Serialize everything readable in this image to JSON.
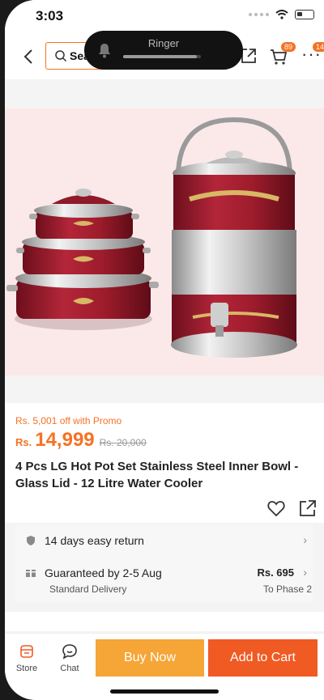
{
  "status_bar": {
    "time": "3:03"
  },
  "header": {
    "search_text": "Sea",
    "cart_badge": "89",
    "more_badge": "14"
  },
  "ringer": {
    "label": "Ringer",
    "level": 0.95
  },
  "product": {
    "promo": "Rs. 5,001 off with Promo",
    "currency": "Rs.",
    "price": "14,999",
    "old_price": "Rs. 20,000",
    "title": "4 Pcs LG Hot Pot Set Stainless Steel Inner Bowl - Glass Lid - 12 Litre Water Cooler"
  },
  "delivery": {
    "return_text": "14 days easy return",
    "guarantee_text": "Guaranteed by 2-5 Aug",
    "delivery_type": "Standard Delivery",
    "fee": "Rs. 695",
    "destination": "To Phase 2"
  },
  "bottom_bar": {
    "store_label": "Store",
    "chat_label": "Chat",
    "buy_now_label": "Buy Now",
    "add_to_cart_label": "Add to Cart"
  },
  "colors": {
    "accent": "#f57224",
    "buy_now": "#f6a537",
    "add_to_cart": "#f05a23",
    "product_red": "#9e1c2c"
  }
}
